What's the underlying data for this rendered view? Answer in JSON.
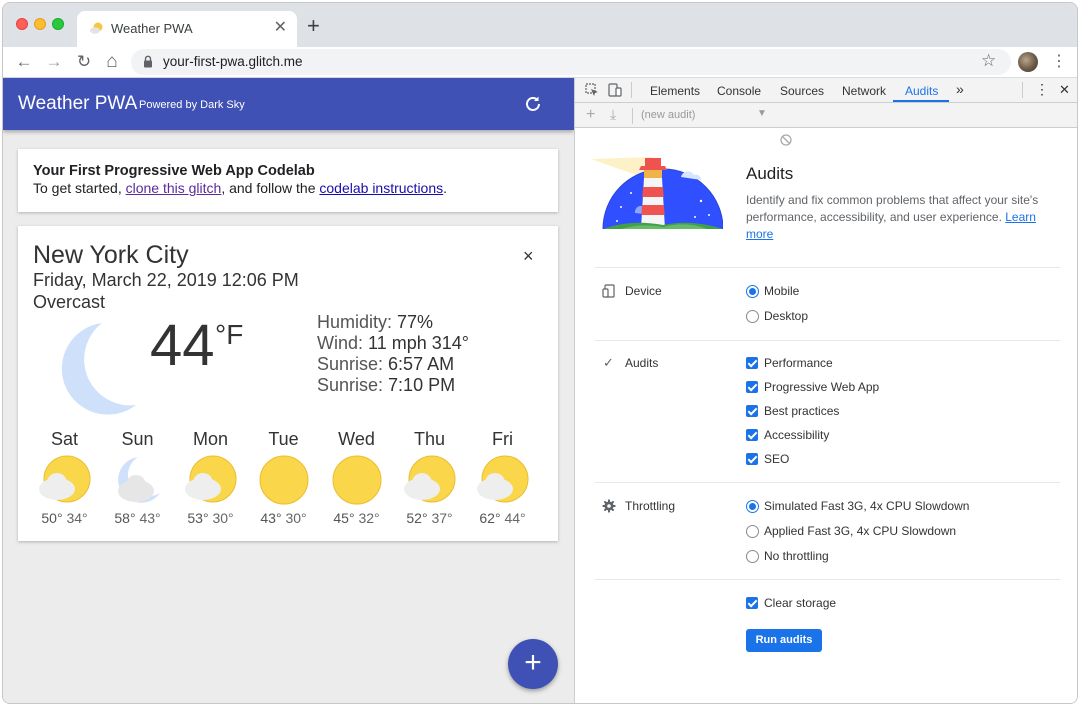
{
  "browser": {
    "tab_title": "Weather PWA",
    "tab_close": "✕",
    "new_tab": "+",
    "url": "your-first-pwa.glitch.me",
    "back": "←",
    "forward": "→",
    "reload": "↻",
    "home": "⌂",
    "star": "☆",
    "menu": "⋮"
  },
  "app": {
    "title": "Weather PWA",
    "powered": "Powered by Dark Sky",
    "intro": {
      "title": "Your First Progressive Web App Codelab",
      "text_before": "To get started, ",
      "link1": "clone this glitch",
      "text_middle": ", and follow the ",
      "link2": "codelab instructions",
      "text_after": "."
    },
    "weather": {
      "city": "New York City",
      "close": "×",
      "date": "Friday, March 22, 2019 12:06 PM",
      "condition": "Overcast",
      "temp": "44",
      "unit": "°F",
      "humidity_label": "Humidity: ",
      "humidity": "77%",
      "wind_label": "Wind: ",
      "wind": "11 mph 314°",
      "sunrise_label": "Sunrise: ",
      "sunrise": "6:57 AM",
      "sunset_label": "Sunrise: ",
      "sunset": "7:10 PM",
      "forecast": [
        {
          "day": "Sat",
          "hi": "50°",
          "lo": "34°",
          "icon": "partly-cloudy-day-icon"
        },
        {
          "day": "Sun",
          "hi": "58°",
          "lo": "43°",
          "icon": "partly-cloudy-night-icon"
        },
        {
          "day": "Mon",
          "hi": "53°",
          "lo": "30°",
          "icon": "partly-cloudy-day-icon"
        },
        {
          "day": "Tue",
          "hi": "43°",
          "lo": "30°",
          "icon": "sun-icon"
        },
        {
          "day": "Wed",
          "hi": "45°",
          "lo": "32°",
          "icon": "sun-icon"
        },
        {
          "day": "Thu",
          "hi": "52°",
          "lo": "37°",
          "icon": "partly-cloudy-day-icon"
        },
        {
          "day": "Fri",
          "hi": "62°",
          "lo": "44°",
          "icon": "partly-cloudy-day-icon"
        }
      ]
    },
    "fab": "+"
  },
  "devtools": {
    "tabs": [
      "Elements",
      "Console",
      "Sources",
      "Network",
      "Audits"
    ],
    "more": "»",
    "menu": "⋮",
    "close": "✕",
    "sub": {
      "add": "+",
      "download": "⤓",
      "select": "(new audit)",
      "arrow": "▼",
      "clear": "⃠"
    },
    "audits": {
      "title": "Audits",
      "desc": "Identify and fix common problems that affect your site's performance, accessibility, and user experience. ",
      "learn_more": "Learn more",
      "device_label": "Device",
      "device_options": [
        "Mobile",
        "Desktop"
      ],
      "audits_label": "Audits",
      "audit_options": [
        "Performance",
        "Progressive Web App",
        "Best practices",
        "Accessibility",
        "SEO"
      ],
      "throttling_label": "Throttling",
      "throttling_options": [
        "Simulated Fast 3G, 4x CPU Slowdown",
        "Applied Fast 3G, 4x CPU Slowdown",
        "No throttling"
      ],
      "clear_storage": "Clear storage",
      "run": "Run audits"
    }
  }
}
